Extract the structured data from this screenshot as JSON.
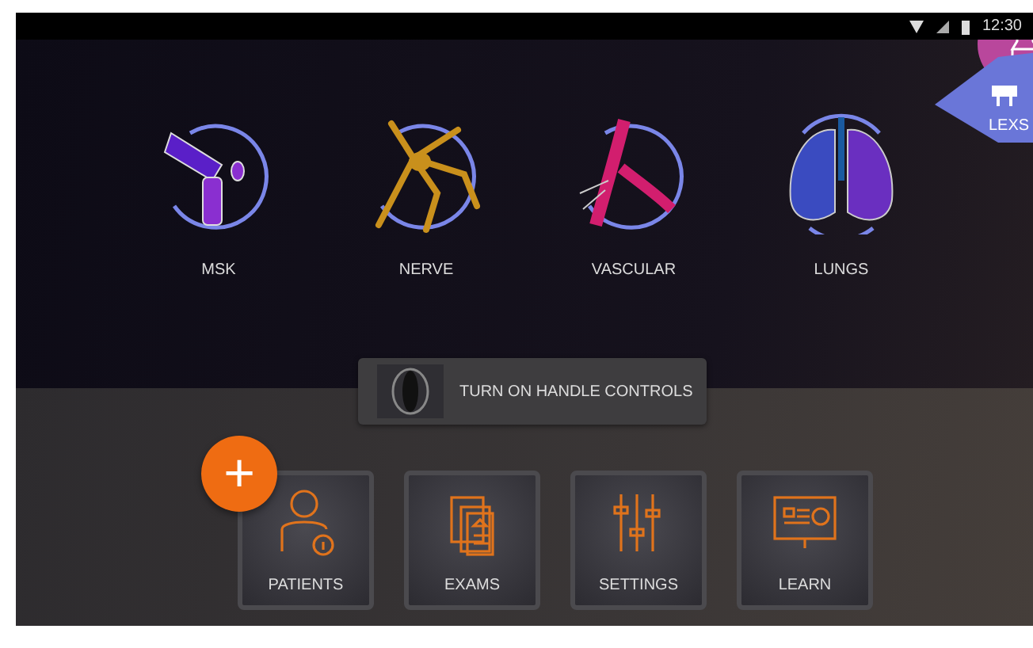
{
  "status_bar": {
    "time": "12:30"
  },
  "probe_menu": {
    "label": "LEXS"
  },
  "presets": [
    {
      "kind": "msk",
      "label": "MSK"
    },
    {
      "kind": "nerve",
      "label": "NERVE"
    },
    {
      "kind": "vascular",
      "label": "VASCULAR"
    },
    {
      "kind": "lungs",
      "label": "LUNGS"
    }
  ],
  "toast": {
    "text": "TURN ON HANDLE CONTROLS"
  },
  "fab": {
    "label": "+"
  },
  "tiles": [
    {
      "kind": "patients",
      "label": "PATIENTS"
    },
    {
      "kind": "exams",
      "label": "EXAMS"
    },
    {
      "kind": "settings",
      "label": "SETTINGS"
    },
    {
      "kind": "learn",
      "label": "LEARN"
    }
  ]
}
